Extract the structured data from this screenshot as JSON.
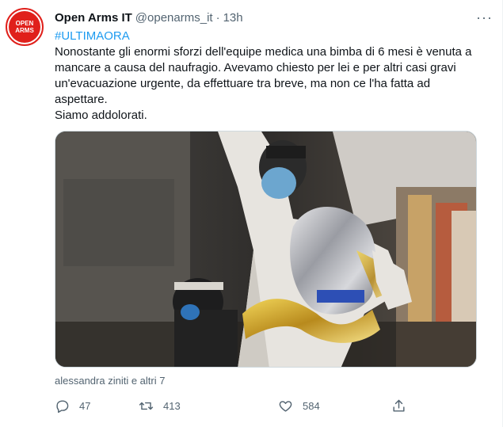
{
  "account": {
    "name": "Open Arms IT",
    "handle": "@openarms_it",
    "separator": "·",
    "time": "13h",
    "avatar_text": [
      "OPEN",
      "ARMS"
    ],
    "avatar_color": "#e0201b"
  },
  "tweet": {
    "hashtag": "#ULTIMAORA",
    "body": "Nonostante gli enormi sforzi dell'equipe medica una bimba di 6 mesi è venuta a mancare a causa del naufragio. Avevamo chiesto per lei e per altri casi gravi un'evacuazione urgente, da effettuare tra breve, ma non ce l'ha fatta ad aspettare.",
    "closing": "Siamo addolorati."
  },
  "media": {
    "icon": "photo-icon"
  },
  "liked_by": "alessandra ziniti e altri 7",
  "actions": {
    "reply_count": "47",
    "retweet_count": "413",
    "like_count": "584"
  },
  "colors": {
    "link": "#1d9bf0",
    "secondary_text": "#536471"
  }
}
